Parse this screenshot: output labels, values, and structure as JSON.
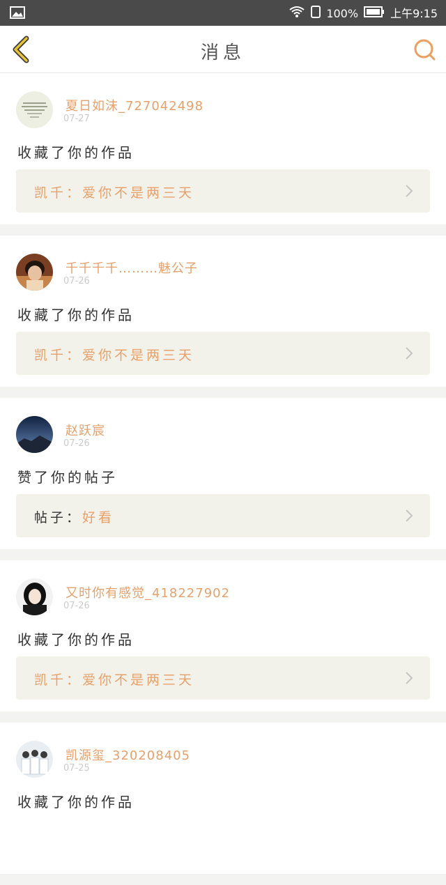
{
  "status_bar": {
    "battery_text": "100%",
    "time": "上午9:15"
  },
  "nav": {
    "title": "消息"
  },
  "messages": [
    {
      "username": "夏日如沫_727042498",
      "date": "07-27",
      "action": "收藏了你的作品",
      "work_prefix": "凯千：",
      "work_title": "爱你不是两三天",
      "avatar": "book-cover"
    },
    {
      "username": "千千千千………魅公子",
      "date": "07-26",
      "action": "收藏了你的作品",
      "work_prefix": "凯千：",
      "work_title": "爱你不是两三天",
      "avatar": "boy-photo"
    },
    {
      "username": "赵跃宸",
      "date": "07-26",
      "action": "赞了你的帖子",
      "work_prefix": "帖子：",
      "work_title": "好看",
      "avatar": "mountain-night"
    },
    {
      "username": "又时你有感觉_418227902",
      "date": "07-26",
      "action": "收藏了你的作品",
      "work_prefix": "凯千：",
      "work_title": "爱你不是两三天",
      "avatar": "girl-photo"
    },
    {
      "username": "凯源玺_320208405",
      "date": "07-25",
      "action": "收藏了你的作品",
      "work_prefix": "",
      "work_title": "",
      "avatar": "group-photo"
    }
  ],
  "colors": {
    "accent": "#e8a06a",
    "status_bar": "#4a4a4a",
    "work_bg": "#f3f2ea"
  }
}
